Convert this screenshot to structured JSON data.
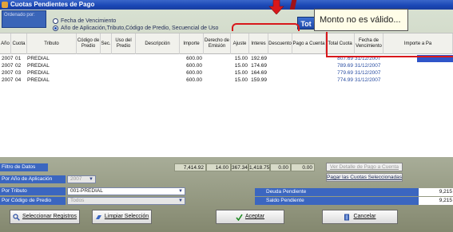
{
  "window": {
    "title": "Cuotas Pendientes de Pago"
  },
  "sort": {
    "label": "Ordenado por:",
    "option_1": "Fecha de Vencimiento",
    "option_2": "Año de Aplicación,Tributo,Código de Predio, Secuencial de Uso",
    "selected": "option_2"
  },
  "total_button": {
    "label": "Tot"
  },
  "tooltip": {
    "text": "Monto no es válido..."
  },
  "grid": {
    "columns": [
      "Año",
      "Cuota",
      "Tributo",
      "Código de Predio",
      "Sec.",
      "Uso del Predio",
      "Descripción",
      "Importe",
      "Derecho de Emisión",
      "Ajuste",
      "Interes",
      "Descuento",
      "Pago a Cuenta",
      "Total Cuota",
      "Fecha de Vencimiento",
      "Importe a Pa"
    ],
    "rows": [
      {
        "anio": "2007",
        "cuota": "01",
        "tributo": "PREDIAL",
        "importe": "600.00",
        "ajuste": "15.00",
        "interes": "192.69",
        "total": "807.69",
        "vence": "31/12/2007"
      },
      {
        "anio": "2007",
        "cuota": "02",
        "tributo": "PREDIAL",
        "importe": "600.00",
        "ajuste": "15.00",
        "interes": "174.69",
        "total": "789.69",
        "vence": "31/12/2007"
      },
      {
        "anio": "2007",
        "cuota": "03",
        "tributo": "PREDIAL",
        "importe": "600.00",
        "ajuste": "15.00",
        "interes": "164.69",
        "total": "779.69",
        "vence": "31/12/2007"
      },
      {
        "anio": "2007",
        "cuota": "04",
        "tributo": "PREDIAL",
        "importe": "600.00",
        "ajuste": "15.00",
        "interes": "159.99",
        "total": "774.99",
        "vence": "31/12/2007"
      }
    ]
  },
  "totals": {
    "importe": "7,414.92",
    "derecho": "14.00",
    "ajuste": "367.34",
    "interes": "1,418.75",
    "descuento": "0.00",
    "pago_cuenta": "0.00"
  },
  "filters": {
    "title": "Filtro de Datos",
    "anio_label": "Por Año de Aplicación",
    "anio_value": "2007",
    "tributo_label": "Por Tributo",
    "tributo_value": "001-PREDIAL",
    "predio_label": "Por Código de Predio",
    "predio_value": "Todos"
  },
  "links": {
    "ver_detalle": "Ver Detalle de Pago a Cuenta",
    "pagar_todas": "Pagar las Cuotas Seleccionadas"
  },
  "summary": {
    "deuda_label": "Deuda Pendiente",
    "deuda_value": "9,215",
    "saldo_label": "Saldo Pendiente",
    "saldo_value": "9,215"
  },
  "buttons": {
    "seleccionar": "Seleccionar Registros",
    "limpiar": "Limpiar Selección",
    "aceptar": "Aceptar",
    "cancelar": "Cancelar"
  }
}
